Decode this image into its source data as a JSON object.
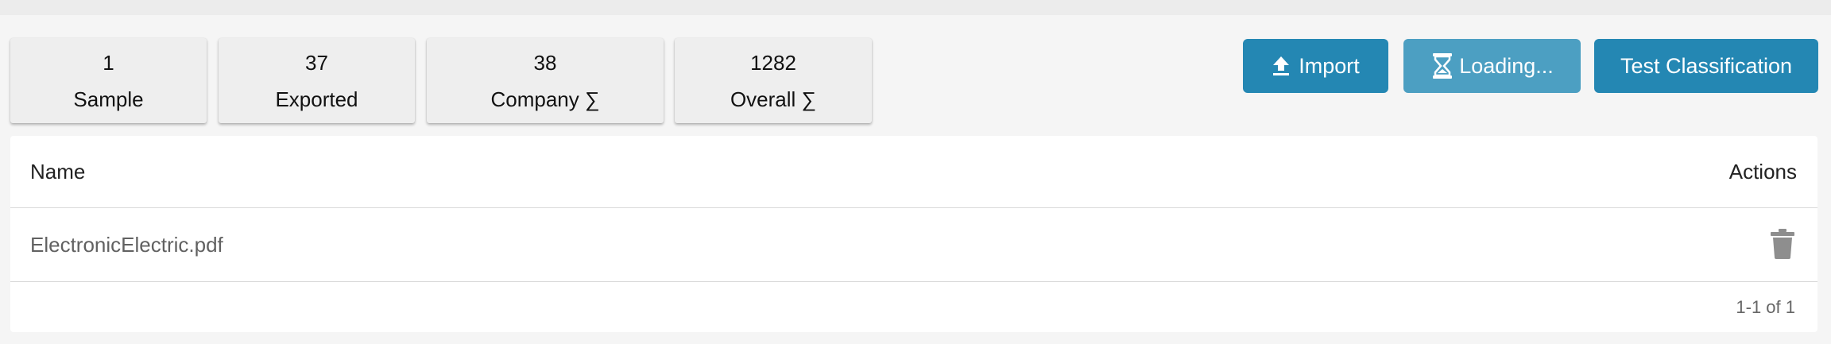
{
  "stats": [
    {
      "value": "1",
      "label": "Sample"
    },
    {
      "value": "37",
      "label": "Exported"
    },
    {
      "value": "38",
      "label": "Company ∑"
    },
    {
      "value": "1282",
      "label": "Overall ∑"
    }
  ],
  "toolbar": {
    "import_label": "Import",
    "import_icon": "upload-icon",
    "loading_label": "Loading...",
    "loading_icon": "hourglass-icon",
    "test_label": "Test Classification"
  },
  "table": {
    "headers": {
      "name": "Name",
      "actions": "Actions"
    },
    "rows": [
      {
        "name": "ElectronicElectric.pdf",
        "action_icon": "trash-icon"
      }
    ],
    "pagination": "1-1 of 1"
  },
  "colors": {
    "primary": "#2487b3",
    "primary_loading": "#4c9fc2",
    "card_bg": "#eeeeee",
    "page_bg": "#f5f5f5"
  }
}
